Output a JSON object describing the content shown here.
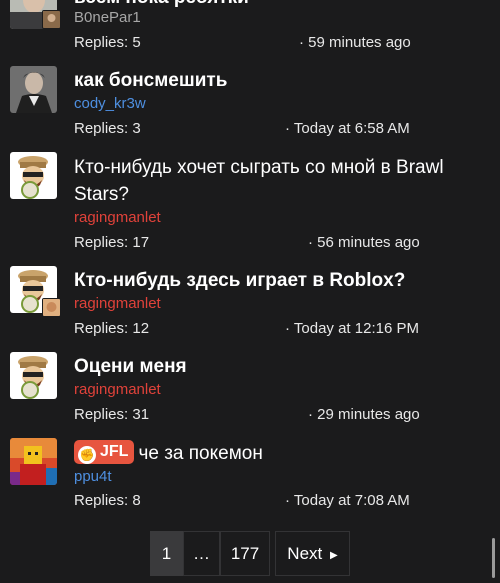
{
  "threads": [
    {
      "title": "всем пока ребятки",
      "author": "B0nePar1",
      "replies": "Replies: 5",
      "time": "· 59 minutes ago"
    },
    {
      "title": "как бонсмешить",
      "author": "cody_kr3w",
      "replies": "Replies: 3",
      "time": "· Today at 6:58 AM"
    },
    {
      "title": "Кто-нибудь хочет сыграть со мной в Brawl Stars?",
      "author": "ragingmanlet",
      "replies": "Replies: 17",
      "time": "· 56 minutes ago"
    },
    {
      "title": "Кто-нибудь здесь играет в Roblox?",
      "author": "ragingmanlet",
      "replies": "Replies: 12",
      "time": "· Today at 12:16 PM"
    },
    {
      "title": "Оцени меня",
      "author": "ragingmanlet",
      "replies": "Replies: 31",
      "time": "· 29 minutes ago"
    },
    {
      "badge": "JFL",
      "title": "че за покемон",
      "author": "ppu4t",
      "replies": "Replies: 8",
      "time": "· Today at 7:08 AM"
    }
  ],
  "pagination": {
    "current": "1",
    "ellipsis": "…",
    "last": "177",
    "next": "Next"
  },
  "colors": {
    "background": "#1b1b1c",
    "author_red": "#e0423a",
    "author_blue": "#4e8fe0",
    "badge": "#e7553f"
  },
  "icons": {
    "next": "chevron-right-icon",
    "badge": "jfl-badge-icon"
  }
}
